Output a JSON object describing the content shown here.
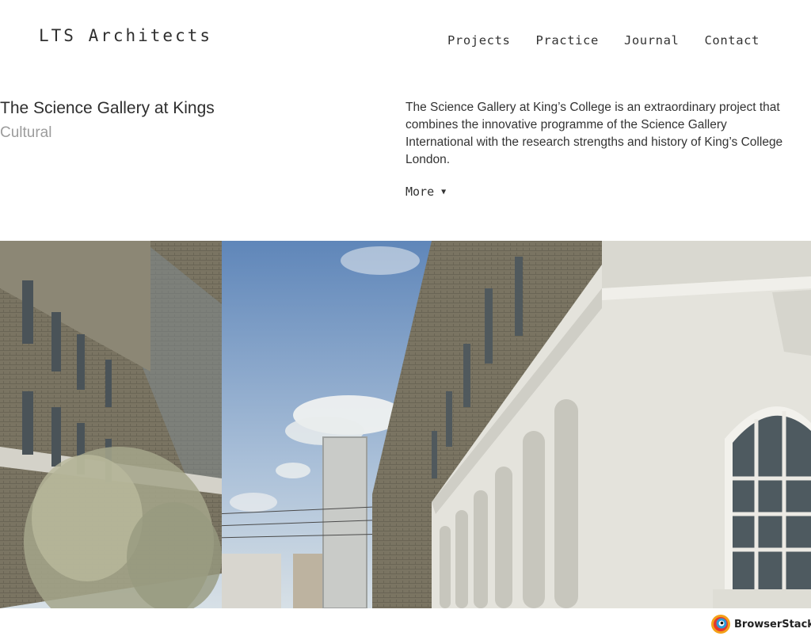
{
  "header": {
    "logo": "LTS Architects",
    "nav": [
      "Projects",
      "Practice",
      "Journal",
      "Contact"
    ]
  },
  "project": {
    "title": "The Science Gallery at Kings",
    "category": "Cultural",
    "description": "The Science Gallery at King’s College is an extraordinary project that combines the innovative programme of the Science Gallery International with the research strengths and history of King’s College London.",
    "more_label": "More"
  },
  "footer": {
    "badge_label": "BrowserStack"
  },
  "colors": {
    "sky": "#8aa8cf",
    "brick": "#7c7664",
    "stucco": "#e6e5df",
    "window": "#4e5a60"
  },
  "icons": [
    "triangle-down-icon",
    "browserstack-logo-icon"
  ]
}
